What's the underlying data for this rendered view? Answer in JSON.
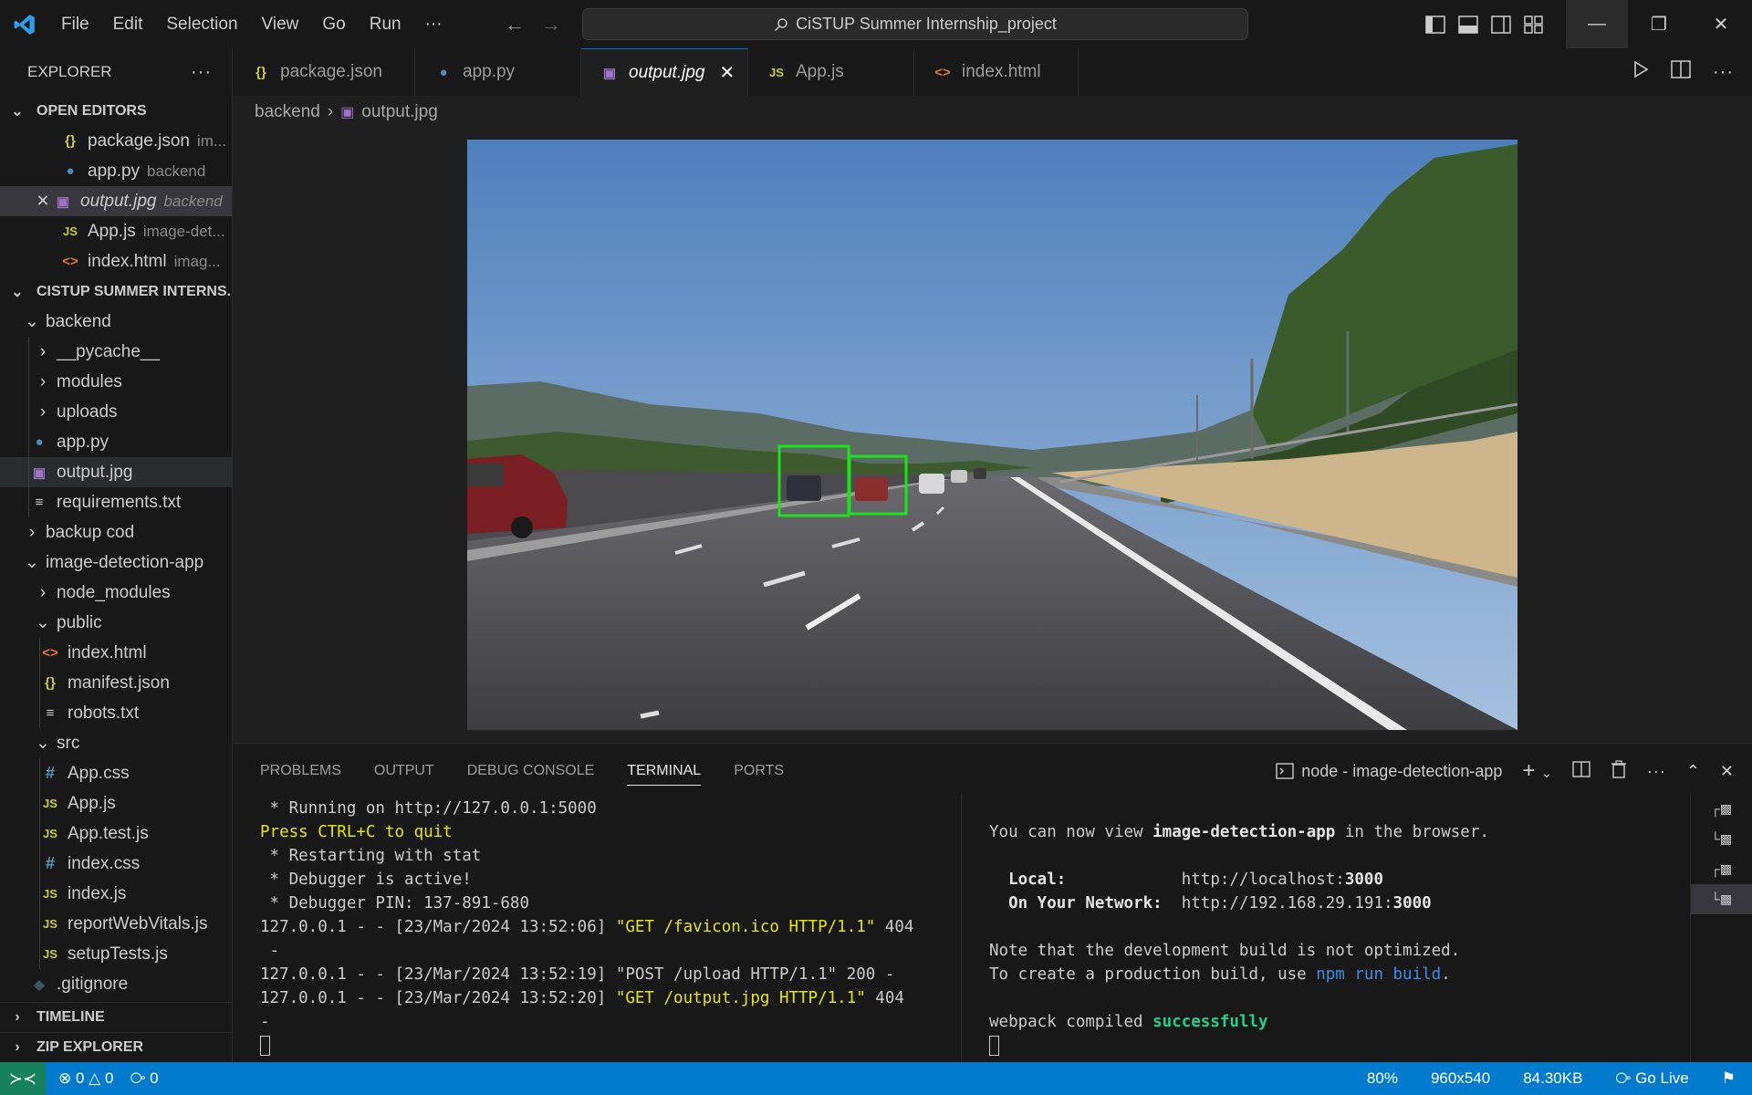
{
  "titlebar": {
    "menu": [
      "File",
      "Edit",
      "Selection",
      "View",
      "Go",
      "Run",
      "···"
    ],
    "search_text": "CiSTUP Summer Internship_project"
  },
  "explorer": {
    "header": "EXPLORER",
    "open_editors_title": "OPEN EDITORS",
    "open_editors": [
      {
        "name": "package.json",
        "desc": "im...",
        "icon": "json-icon"
      },
      {
        "name": "app.py",
        "desc": "backend",
        "icon": "python-icon"
      },
      {
        "name": "output.jpg",
        "desc": "backend",
        "icon": "image-icon"
      },
      {
        "name": "App.js",
        "desc": "image-det...",
        "icon": "js-icon"
      },
      {
        "name": "index.html",
        "desc": "imag...",
        "icon": "html-icon"
      }
    ],
    "project_title": "CISTUP SUMMER INTERNS...",
    "tree": {
      "backend": "backend",
      "pycache": "__pycache__",
      "modules": "modules",
      "uploads": "uploads",
      "app_py": "app.py",
      "output_jpg": "output.jpg",
      "requirements": "requirements.txt",
      "backup": "backup cod",
      "image_app": "image-detection-app",
      "node_modules": "node_modules",
      "public": "public",
      "index_html": "index.html",
      "manifest": "manifest.json",
      "robots": "robots.txt",
      "src": "src",
      "app_css": "App.css",
      "app_js": "App.js",
      "app_test": "App.test.js",
      "index_css": "index.css",
      "index_js": "index.js",
      "report": "reportWebVitals.js",
      "setup": "setupTests.js",
      "gitignore": ".gitignore"
    },
    "timeline": "TIMELINE",
    "zip": "ZIP EXPLORER"
  },
  "tabs": [
    {
      "label": "package.json",
      "icon": "json-icon"
    },
    {
      "label": "app.py",
      "icon": "python-icon"
    },
    {
      "label": "output.jpg",
      "icon": "image-icon",
      "active": true
    },
    {
      "label": "App.js",
      "icon": "js-icon"
    },
    {
      "label": "index.html",
      "icon": "html-icon"
    }
  ],
  "breadcrumb": {
    "folder": "backend",
    "file": "output.jpg"
  },
  "panel": {
    "tabs": [
      "PROBLEMS",
      "OUTPUT",
      "DEBUG CONSOLE",
      "TERMINAL",
      "PORTS"
    ],
    "terminal_name": "node - image-detection-app"
  },
  "term1": {
    "l1": " * Running on http://127.0.0.1:5000",
    "l2": "Press CTRL+C to quit",
    "l3": " * Restarting with stat",
    "l4": " * Debugger is active!",
    "l5": " * Debugger PIN: 137-891-680",
    "l6a": "127.0.0.1 - - [23/Mar/2024 13:52:06] ",
    "l6b": "\"GET /favicon.ico HTTP/1.1\"",
    "l6c": " 404",
    "l7": " -",
    "l8": "127.0.0.1 - - [23/Mar/2024 13:52:19] \"POST /upload HTTP/1.1\" 200 -",
    "l9a": "127.0.0.1 - - [23/Mar/2024 13:52:20] ",
    "l9b": "\"GET /output.jpg HTTP/1.1\"",
    "l9c": " 404",
    "l10": "-"
  },
  "term2": {
    "l1a": "You can now view ",
    "l1b": "image-detection-app",
    "l1c": " in the browser.",
    "local_label": "  Local:",
    "local_url_a": "            http://localhost:",
    "local_url_b": "3000",
    "net_label": "  On Your Network:",
    "net_url_a": "  http://192.168.29.191:",
    "net_url_b": "3000",
    "note1": "Note that the development build is not optimized.",
    "note2a": "To create a production build, use ",
    "note2b": "npm run build",
    "note2c": ".",
    "webpack_a": "webpack compiled ",
    "webpack_b": "successfully"
  },
  "status": {
    "errors": "0",
    "warnings": "0",
    "ports": "0",
    "zoom": "80%",
    "dims": "960x540",
    "size": "84.30KB",
    "golive": "Go Live"
  }
}
